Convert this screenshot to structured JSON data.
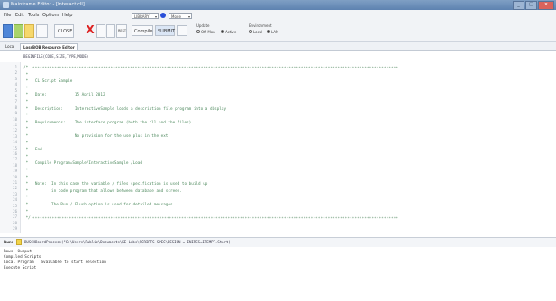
{
  "window": {
    "title": "Mainframe Editor - [Interact.cll]"
  },
  "menu": {
    "items": [
      "File",
      "Edit",
      "Tools",
      "Options",
      "Help"
    ]
  },
  "toolbar_combos": {
    "left_value": "LIBRARY",
    "right_value": "Mode"
  },
  "toolbar": {
    "close_label": "CLOSE",
    "x_label": "X",
    "rest_label": "REST",
    "compile_label": "Compile",
    "submit_label": "SUBMIT",
    "update_group_label": "Update",
    "update_opt1": "Off-Mon",
    "update_opt2": "Active",
    "environment_group_label": "Environment",
    "environment_opt1": "Local",
    "environment_opt2": "LAN"
  },
  "tabs": [
    {
      "label": "Local"
    },
    {
      "label": "LossBOB Resource Editor"
    }
  ],
  "editor": {
    "path_line": "BEGINFILE(CODE,SIZE,TYPE,MODE)",
    "line_numbers": [
      "1",
      "2",
      "3",
      "4",
      "5",
      "6",
      "7",
      "8",
      "9",
      "10",
      "11",
      "12",
      "13",
      "14",
      "15",
      "16",
      "17",
      "18",
      "19",
      "20",
      "21",
      "22",
      "23",
      "24",
      "25",
      "26",
      "27",
      "28",
      "29"
    ],
    "code_lines": [
      "/*",
      " *",
      " *   CL Script Sample",
      " *",
      " *   Date:            15 April 2012",
      " *",
      " *   Description:     InteractiveSample loads a description file program into a display",
      " *",
      " *   Requirements:    The interface program (both the cll and the files)",
      " *",
      " *                    No provision for the use plus in the ext.",
      " *",
      " *   End",
      " *",
      " *   Compile Program=Sample/InteractiveSample /Load",
      " *",
      " *",
      " *   Note:  In this case the variable / files specification is used to build up",
      " *          in code program that allows between database and screen.",
      " *",
      " *          The Run / Flush option is used for detailed messages",
      " *",
      " */"
    ]
  },
  "command_bar": {
    "prompt": "Run:",
    "command": "BUSCHBoardProcess(\"C:\\Users\\Public\\Documents\\KE Labs\\SCRIPTS SPEC\\DESIGN = INIRES=ITEMPT.Start)"
  },
  "output": {
    "lines": [
      "Rows: Output",
      "Compiled Scripts",
      "Local Program   available to start selection",
      "Execute Script"
    ]
  }
}
